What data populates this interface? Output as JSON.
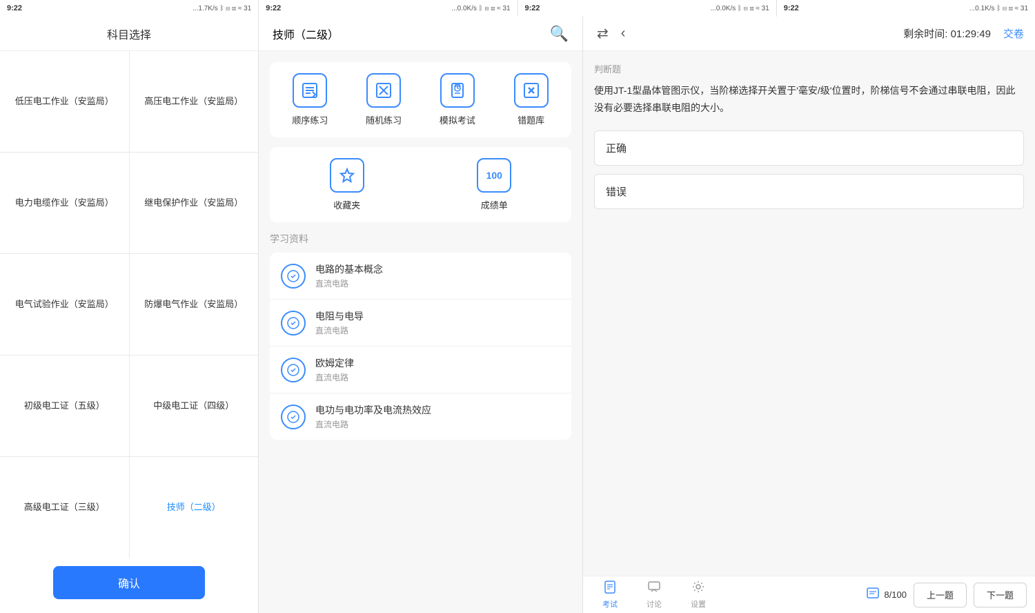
{
  "statusBars": [
    {
      "time": "9:22",
      "info": "...1.7K/s ᛒ ✕ ⊠ ≈ 31"
    },
    {
      "time": "9:22",
      "info": "...0.0K/s ᛒ ✕ ⊠ ≈ 31"
    },
    {
      "time": "9:22",
      "info": "...0.0K/s ᛒ ✕ ⊠ ≈ 31"
    },
    {
      "time": "9:22",
      "info": "...0.1K/s ᛒ ✕ ⊠ ≈ 31"
    }
  ],
  "panel1": {
    "title": "科目选择",
    "subjects": [
      "低压电工作业（安监局）",
      "高压电工作业（安监局）",
      "电力电缆作业（安监局）",
      "继电保护作业（安监局）",
      "电气试验作业（安监局）",
      "防爆电气作业（安监局）",
      "初级电工证（五级）",
      "中级电工证（四级）",
      "高级电工证（三级）",
      "技师（二级）"
    ],
    "confirmLabel": "确认"
  },
  "panel2": {
    "title": "技师（二级）",
    "practiceItems": [
      {
        "label": "顺序练习",
        "icon": "✏️"
      },
      {
        "label": "随机练习",
        "icon": "✂️"
      },
      {
        "label": "模拟考试",
        "icon": "🕐"
      },
      {
        "label": "错题库",
        "icon": "✗"
      }
    ],
    "row2Items": [
      {
        "label": "收藏夹",
        "icon": "⭐"
      },
      {
        "label": "成绩单",
        "icon": "100"
      }
    ],
    "sectionTitle": "学习资料",
    "materials": [
      {
        "title": "电路的基本概念",
        "sub": "直流电路"
      },
      {
        "title": "电阻与电导",
        "sub": "直流电路"
      },
      {
        "title": "欧姆定律",
        "sub": "直流电路"
      },
      {
        "title": "电功与电功率及电流热效应",
        "sub": "直流电路"
      }
    ]
  },
  "panel3": {
    "backIcon": "‹",
    "timerLabel": "剩余时间: 01:29:49",
    "submitLabel": "交卷",
    "questionType": "判断题",
    "questionText": "使用JT-1型晶体管图示仪，当阶梯选择开关置于'毫安/级'位置时，阶梯信号不会通过串联电阻，因此没有必要选择串联电阻的大小。",
    "options": [
      {
        "label": "正确"
      },
      {
        "label": "错误"
      }
    ],
    "footer": {
      "tabs": [
        {
          "label": "考试",
          "icon": "📋",
          "active": true
        },
        {
          "label": "讨论",
          "icon": "💬",
          "active": false
        },
        {
          "label": "设置",
          "icon": "⚙️",
          "active": false
        }
      ],
      "cardIcon": "📄",
      "cardCount": "8/100",
      "prevLabel": "上一题",
      "nextLabel": "下一题"
    }
  }
}
